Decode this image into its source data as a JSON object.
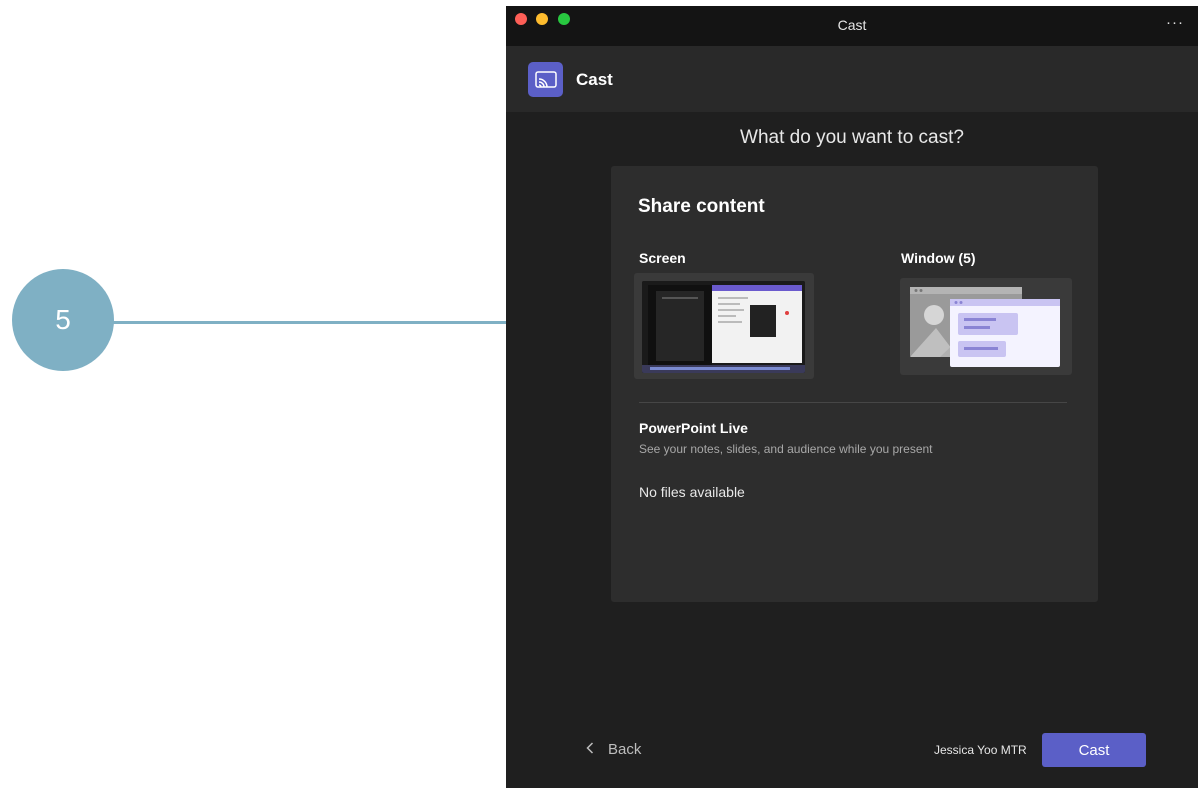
{
  "callout": {
    "number": "5"
  },
  "window": {
    "title": "Cast",
    "more": "···"
  },
  "header": {
    "title": "Cast",
    "icon": "cast-icon"
  },
  "question": "What do you want to cast?",
  "share": {
    "title": "Share content",
    "screen_label": "Screen",
    "window_label": "Window (5)"
  },
  "ppt": {
    "title": "PowerPoint Live",
    "subtitle": "See your notes, slides, and audience while you present",
    "empty": "No files available"
  },
  "footer": {
    "back_label": "Back",
    "user": "Jessica Yoo MTR",
    "cast_label": "Cast"
  },
  "colors": {
    "accent": "#5b5fc7",
    "callout": "#7fb0c4",
    "background": "#1f1f1f"
  }
}
